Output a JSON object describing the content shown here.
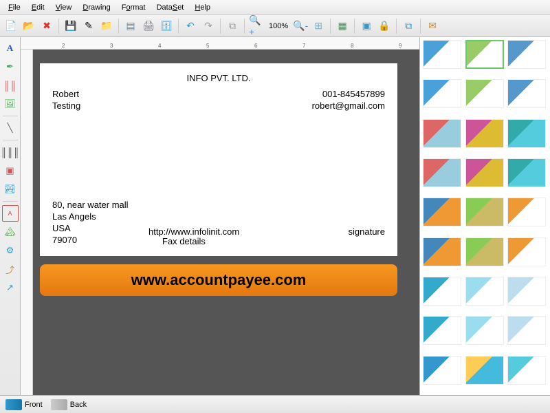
{
  "menubar": [
    "File",
    "Edit",
    "View",
    "Drawing",
    "Format",
    "DataSet",
    "Help"
  ],
  "toolbar": {
    "zoom": "100%"
  },
  "card": {
    "company": "INFO PVT. LTD.",
    "name_line1": "Robert",
    "name_line2": "Testing",
    "phone": "001-845457899",
    "email": "robert@gmail.com",
    "addr1": "80, near water mall",
    "addr2": "Las Angels",
    "addr3": "USA",
    "addr4": "79070",
    "website": "http://www.infolinit.com",
    "fax": "Fax details",
    "signature": "signature"
  },
  "banner": "www.accountpayee.com",
  "ruler_marks": [
    "2",
    "3",
    "4",
    "5",
    "6",
    "7",
    "8",
    "9"
  ],
  "statusbar": {
    "front": "Front",
    "back": "Back"
  },
  "templates": [
    {
      "c1": "#4aa0d8",
      "c2": "#fff"
    },
    {
      "c1": "#9c6",
      "c2": "#fff"
    },
    {
      "c1": "#59c",
      "c2": "#fff"
    },
    {
      "c1": "#4aa0d8",
      "c2": "#fff"
    },
    {
      "c1": "#9c6",
      "c2": "#fff"
    },
    {
      "c1": "#59c",
      "c2": "#fff"
    },
    {
      "c1": "#d66",
      "c2": "#9cd"
    },
    {
      "c1": "#c59",
      "c2": "#db3"
    },
    {
      "c1": "#3aa",
      "c2": "#5cd"
    },
    {
      "c1": "#d66",
      "c2": "#9cd"
    },
    {
      "c1": "#c59",
      "c2": "#db3"
    },
    {
      "c1": "#3aa",
      "c2": "#5cd"
    },
    {
      "c1": "#48b",
      "c2": "#e93"
    },
    {
      "c1": "#8c5",
      "c2": "#cb6"
    },
    {
      "c1": "#e93",
      "c2": "#fff"
    },
    {
      "c1": "#48b",
      "c2": "#e93"
    },
    {
      "c1": "#8c5",
      "c2": "#cb6"
    },
    {
      "c1": "#e93",
      "c2": "#fff"
    },
    {
      "c1": "#3ac",
      "c2": "#fff"
    },
    {
      "c1": "#9de",
      "c2": "#fff"
    },
    {
      "c1": "#bde",
      "c2": "#fff"
    },
    {
      "c1": "#3ac",
      "c2": "#fff"
    },
    {
      "c1": "#9de",
      "c2": "#fff"
    },
    {
      "c1": "#bde",
      "c2": "#fff"
    },
    {
      "c1": "#39c",
      "c2": "#fff"
    },
    {
      "c1": "#fc5",
      "c2": "#4bd"
    },
    {
      "c1": "#5cd",
      "c2": "#fff"
    }
  ]
}
